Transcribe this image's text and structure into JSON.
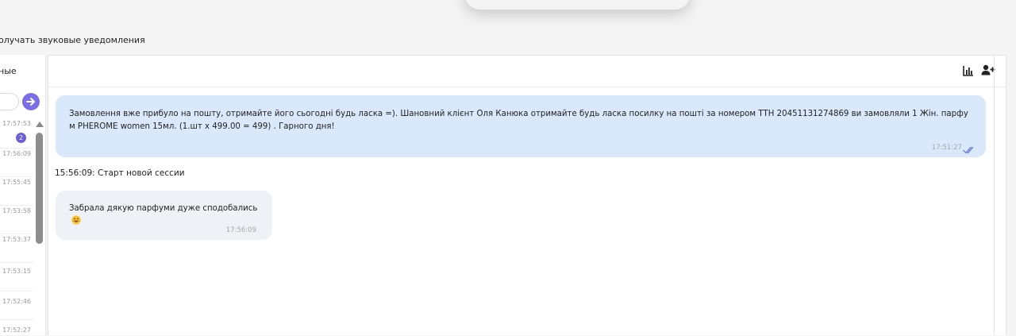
{
  "top": {
    "sound_notifications_label": "олучать звуковые уведомления"
  },
  "left_panel": {
    "filter_label": "ные",
    "go_icon": "arrow-right-icon",
    "items": [
      {
        "time": "17:57:53",
        "unread": "2"
      },
      {
        "time": "17:56:09"
      },
      {
        "time": "17:55:45"
      },
      {
        "time": "17:53:58"
      },
      {
        "time": "17:53:37"
      },
      {
        "time": "17:53:15"
      },
      {
        "time": "17:52:46"
      },
      {
        "time": "17:52:27"
      }
    ]
  },
  "header": {
    "icons": [
      "bar-chart-icon",
      "add-user-icon"
    ]
  },
  "messages": {
    "outgoing": {
      "text": "Замовлення вже прибуло на пошту, отримайте його сьогодні будь ласка =).  Шановний клієнт Оля Канюка отримайте будь ласка посилку на пошті за номером ТТН 20451131274869 ви замовляли 1 Жін. парфум PHEROME women 15мл. (1.шт x 499.00 = 499) . Гарного дня!",
      "time": "17:51:27",
      "status_icon": "double-check-icon"
    },
    "session_line": "15:56:09: Старт новой сессии",
    "incoming": {
      "text": "Забрала дякую парфуми дуже сподобались",
      "emoji_icon": "smiling-face-emoji-icon",
      "time": "17:56:09"
    }
  },
  "colors": {
    "accent": "#7c6ee6",
    "outgoing_bubble": "#d9e9fb",
    "incoming_bubble": "#eef2f7",
    "read_ticks": "#6f86d6"
  }
}
